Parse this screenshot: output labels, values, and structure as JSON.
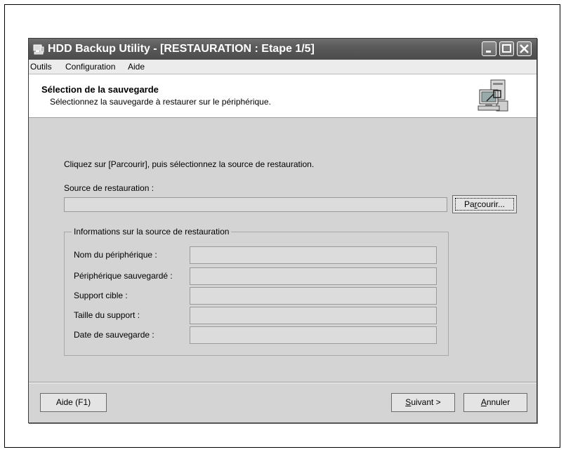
{
  "window": {
    "title": "HDD Backup Utility - [RESTAURATION : Etape 1/5]"
  },
  "menu": [
    {
      "label": "Outils"
    },
    {
      "label": "Configuration"
    },
    {
      "label": "Aide"
    }
  ],
  "header": {
    "title": "Sélection de la sauvegarde",
    "subtitle": "Sélectionnez la sauvegarde à restaurer sur le périphérique.",
    "icon": "restore-computer-icon"
  },
  "main": {
    "instruction": "Cliquez sur [Parcourir], puis sélectionnez la source de restauration.",
    "source_label": "Source de restauration :",
    "source_value": "",
    "browse": {
      "pre": "Pa",
      "key": "r",
      "post": "courir..."
    },
    "info": {
      "legend": "Informations sur la source de restauration",
      "rows": [
        {
          "label": "Nom du périphérique :",
          "value": ""
        },
        {
          "label": "Périphérique sauvegardé :",
          "value": ""
        },
        {
          "label": "Support cible :",
          "value": ""
        },
        {
          "label": "Taille du support :",
          "value": ""
        },
        {
          "label": "Date de sauvegarde :",
          "value": ""
        }
      ]
    }
  },
  "footer": {
    "help": "Aide (F1)",
    "next": {
      "key": "S",
      "rest": "uivant >"
    },
    "cancel": {
      "key": "A",
      "rest": "nnuler"
    }
  }
}
